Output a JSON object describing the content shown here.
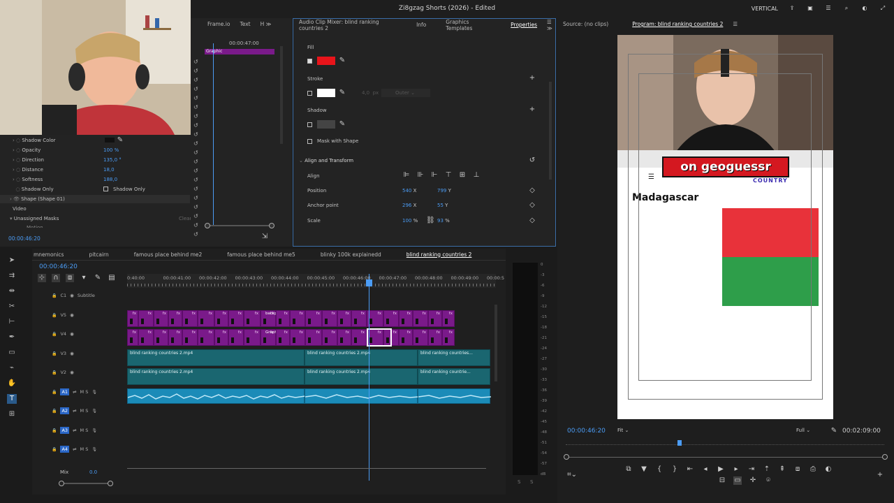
{
  "app": {
    "title": "Zi8gzag Shorts (2026) - Edited",
    "workspace": "VERTICAL"
  },
  "effects_panel": {
    "tabs": [
      "Frame.io",
      "Text"
    ],
    "mini_clip_label": "Graphic",
    "mini_time": "00:00:47:00",
    "rows": [
      {
        "label": "Shadow Color",
        "value": ""
      },
      {
        "label": "Opacity",
        "value": "100 %"
      },
      {
        "label": "Direction",
        "value": "135,0 °"
      },
      {
        "label": "Distance",
        "value": "18,0"
      },
      {
        "label": "Softness",
        "value": "188,0"
      },
      {
        "label": "Shadow Only",
        "value": "Shadow Only"
      }
    ],
    "shape_row": "Shape (Shape 01)",
    "video_label": "Video",
    "masks_label": "Unassigned Masks",
    "clear_all": "Clear all",
    "motion_label": "Motion",
    "timecode": "00:00:46:20"
  },
  "properties_panel": {
    "tabs": [
      "Audio Clip Mixer: blind ranking countries 2",
      "Info",
      "Graphics Templates",
      "Properties"
    ],
    "fill_label": "Fill",
    "fill_color": "#e8141a",
    "stroke_label": "Stroke",
    "stroke_width": "4,0",
    "stroke_unit": "px",
    "stroke_type": "Outer",
    "shadow_label": "Shadow",
    "mask_label": "Mask with Shape",
    "align_transform": "Align and Transform",
    "align_label": "Align",
    "position_label": "Position",
    "position_x": "540",
    "position_y": "799",
    "anchor_label": "Anchor point",
    "anchor_x": "296",
    "anchor_y": "55",
    "scale_label": "Scale",
    "scale_x": "100",
    "scale_y": "93",
    "x": "X",
    "y": "Y",
    "pct": "%"
  },
  "program_monitor": {
    "source_tab": "Source: (no clips)",
    "program_tab": "Program: blind ranking countries 2",
    "banner_text": "on geoguessr",
    "banner_sub": "COUNTRY",
    "country_name": "Madagascar",
    "timecode": "00:00:46:20",
    "fit": "Fit",
    "quality": "Full",
    "duration": "00:02:09:00"
  },
  "timeline": {
    "tabs": [
      "mnemonics",
      "pitcairn",
      "famous place behind me2",
      "famous place behind me5",
      "blinky 100k explainedd",
      "blind ranking countries 2"
    ],
    "timecode": "00:00:46:20",
    "ruler_labels": [
      "0:40:00",
      "00:00:41:00",
      "00:00:42:00",
      "00:00:43:00",
      "00:00:44:00",
      "00:00:45:00",
      "00:00:46:00",
      "00:00:47:00",
      "00:00:48:00",
      "00:00:49:00",
      "00:00:5"
    ],
    "tracks": [
      {
        "id": "C1",
        "label": "Subtitle"
      },
      {
        "id": "V5",
        "label": ""
      },
      {
        "id": "V4",
        "label": ""
      },
      {
        "id": "V3",
        "label": ""
      },
      {
        "id": "V2",
        "label": ""
      },
      {
        "id": "A1",
        "label": "M  S"
      },
      {
        "id": "A2",
        "label": "M  S"
      },
      {
        "id": "A3",
        "label": "M  S"
      },
      {
        "id": "A4",
        "label": "M  S"
      }
    ],
    "mix_label": "Mix",
    "mix_value": "0.0",
    "clip_names": {
      "backp": "backp...",
      "graphic": "Graphic",
      "v3a": "blind ranking countries 2.mp4",
      "v3b": "blind ranking countries 2.mp4",
      "v3c": "blind ranking countries...",
      "v2a": "blind ranking countries 2.mp4",
      "v2b": "blind ranking countries 2.mp4",
      "v2c": "blind ranking countrie..."
    },
    "fx": "fx"
  },
  "audio_meter": {
    "labels": [
      "0",
      "-3",
      "-6",
      "-9",
      "-12",
      "-15",
      "-18",
      "-21",
      "-24",
      "-27",
      "-30",
      "-33",
      "-36",
      "-39",
      "-42",
      "-45",
      "-48",
      "-51",
      "-54",
      "-57",
      "dB"
    ],
    "solo": "S",
    "solo2": "S"
  },
  "colors": {
    "accent": "#4b9cf5",
    "video_clip": "#7a1a8a",
    "text_clip": "#1a6670",
    "audio_clip": "#1b8bb8",
    "flag_red": "#e8323a",
    "flag_green": "#2e9e4a"
  }
}
